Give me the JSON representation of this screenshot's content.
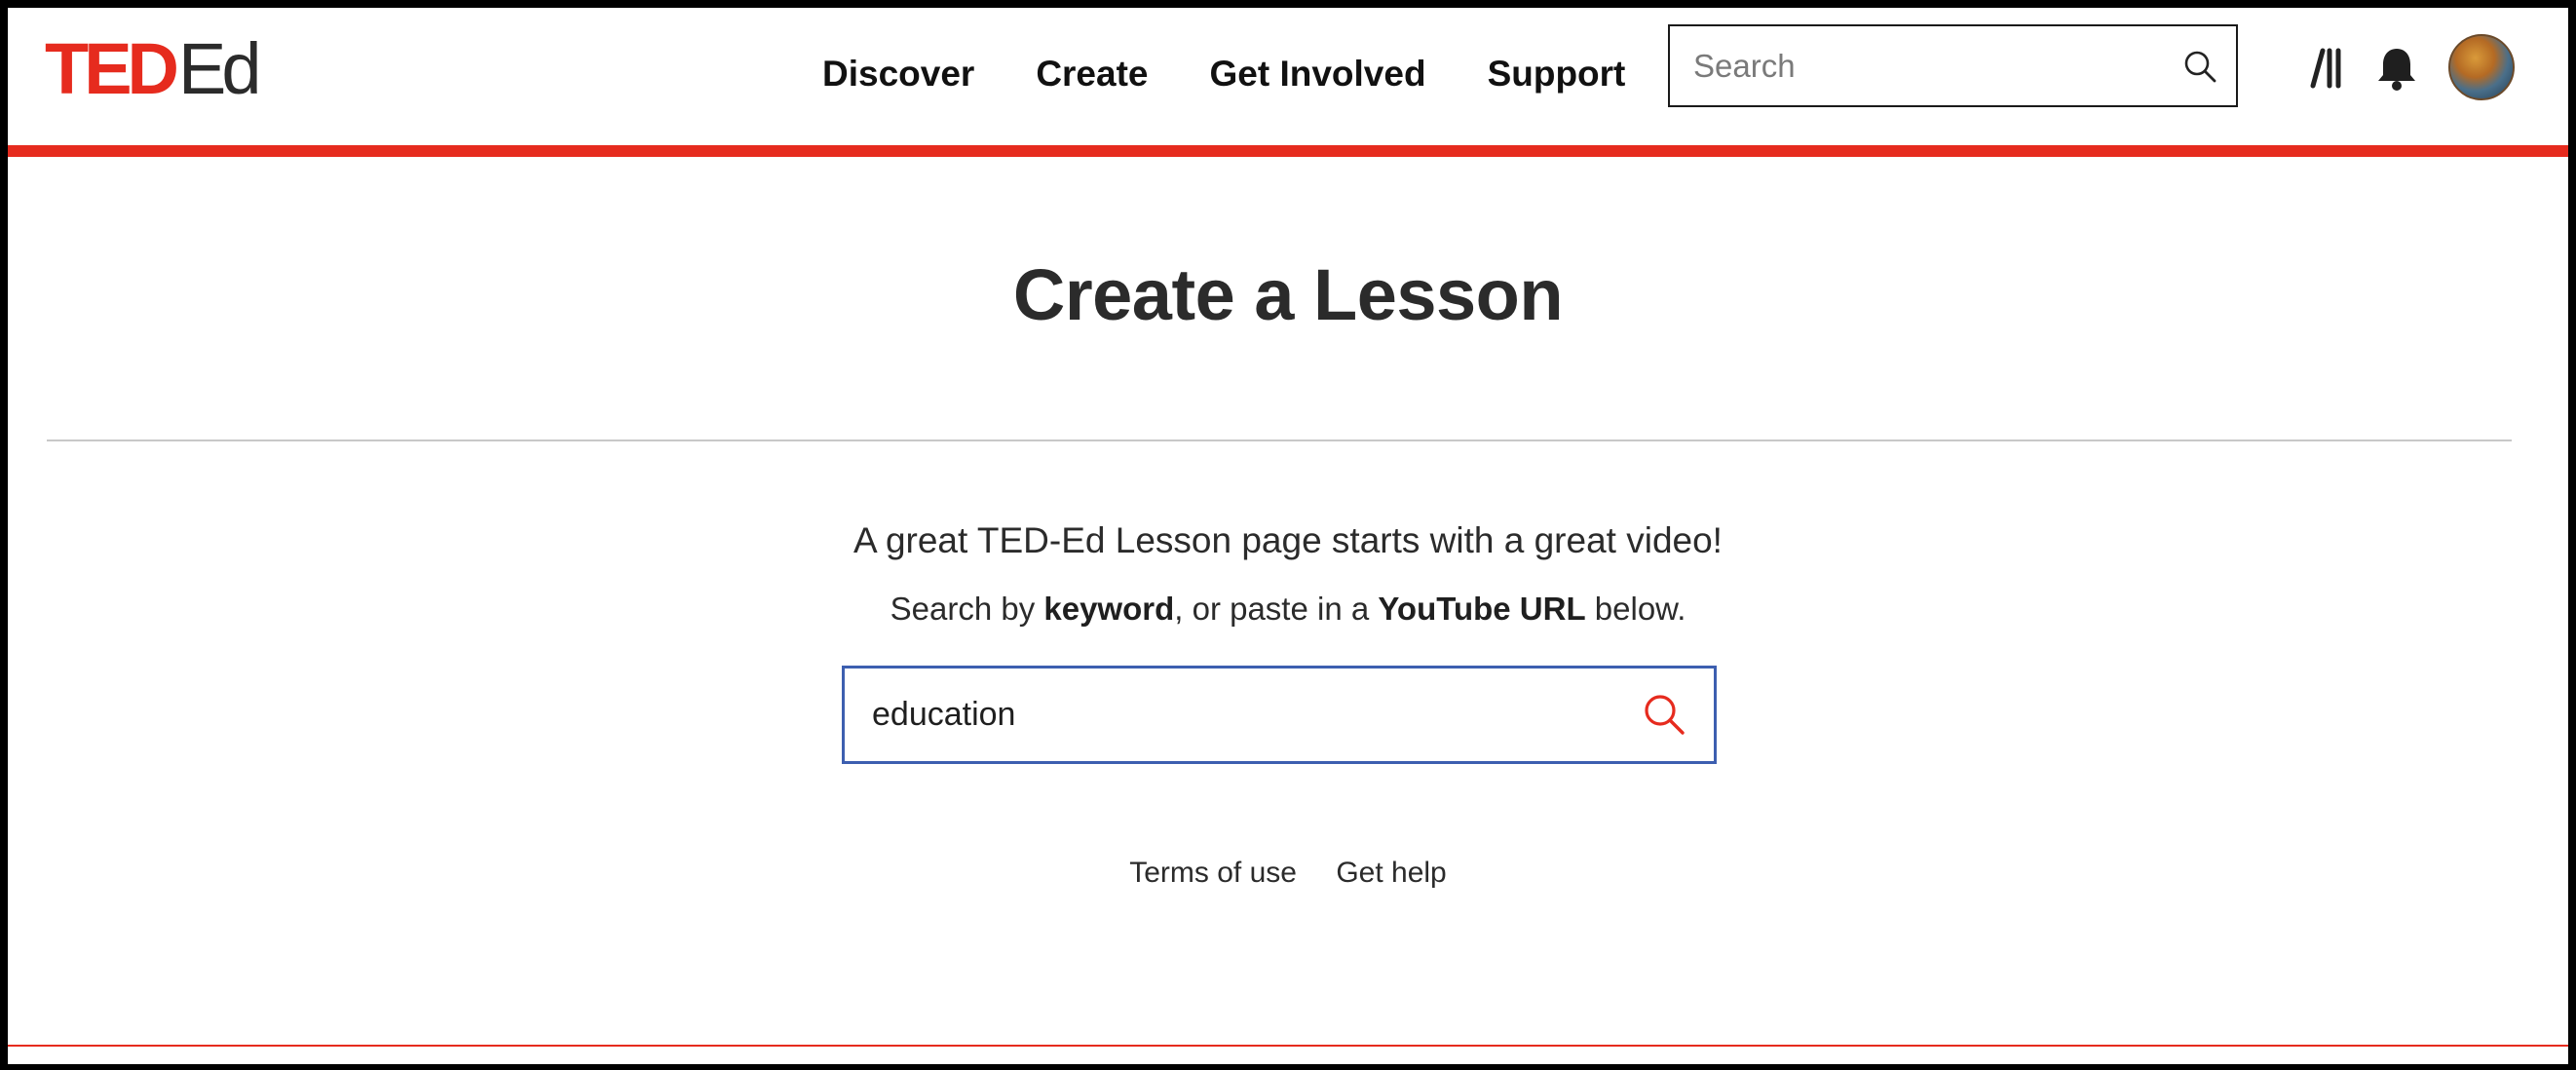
{
  "header": {
    "logo": {
      "ted": "TED",
      "ed": "Ed"
    },
    "nav": [
      {
        "label": "Discover"
      },
      {
        "label": "Create"
      },
      {
        "label": "Get Involved"
      },
      {
        "label": "Support"
      }
    ],
    "search": {
      "placeholder": "Search",
      "value": ""
    },
    "icons": {
      "search": "search-icon",
      "library": "library-icon",
      "notifications": "bell-icon",
      "avatar": "avatar"
    }
  },
  "main": {
    "title": "Create a Lesson",
    "intro": "A great TED-Ed Lesson page starts with a great video!",
    "instruction": {
      "prefix": "Search by ",
      "keyword": "keyword",
      "middle": ", or paste in a ",
      "youtube": "YouTube URL",
      "suffix": " below."
    },
    "search": {
      "value": "education",
      "placeholder": ""
    }
  },
  "footer": {
    "terms": "Terms of use",
    "help": "Get help"
  },
  "colors": {
    "brand_red": "#e62b1e",
    "search_border": "#3d5fb0",
    "text": "#2b2b2b"
  }
}
